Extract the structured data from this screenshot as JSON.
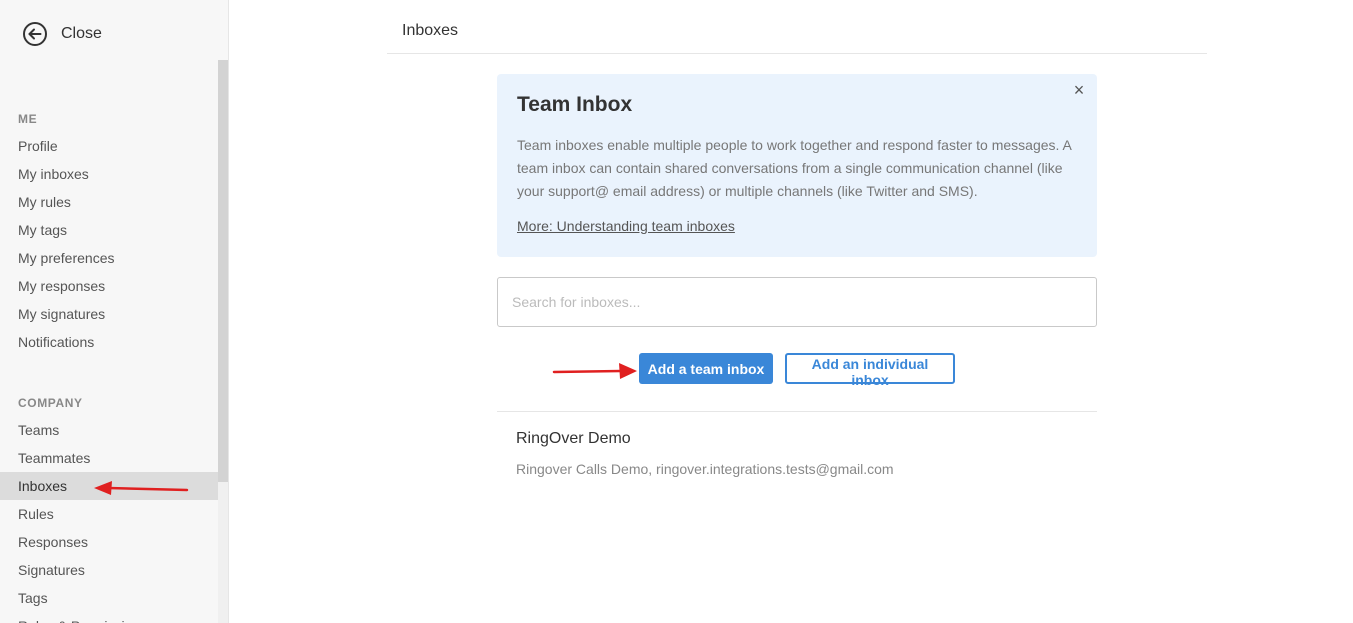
{
  "sidebar": {
    "close_label": "Close",
    "me_title": "ME",
    "me_items": [
      "Profile",
      "My inboxes",
      "My rules",
      "My tags",
      "My preferences",
      "My responses",
      "My signatures",
      "Notifications"
    ],
    "company_title": "COMPANY",
    "company_items": [
      "Teams",
      "Teammates",
      "Inboxes",
      "Rules",
      "Responses",
      "Signatures",
      "Tags",
      "Roles & Permissions"
    ],
    "active_item": "Inboxes"
  },
  "header": {
    "title": "Inboxes"
  },
  "info_card": {
    "title": "Team Inbox",
    "text": "Team inboxes enable multiple people to work together and respond faster to messages. A team inbox can contain shared conversations from a single communication channel (like your support@ email address) or multiple channels (like Twitter and SMS).",
    "link": "More: Understanding team inboxes",
    "close_glyph": "×"
  },
  "search": {
    "placeholder": "Search for inboxes...",
    "value": ""
  },
  "buttons": {
    "add_team": "Add a team inbox",
    "add_individual": "Add an individual inbox"
  },
  "inboxes": [
    {
      "name": "RingOver Demo",
      "description": "Ringover Calls Demo, ringover.integrations.tests@gmail.com"
    }
  ],
  "colors": {
    "accent": "#3a87d8",
    "annotation_arrow": "#e02020",
    "info_bg": "#eaf3fd"
  },
  "icons": {
    "close": "arrow-left-circle-icon"
  }
}
